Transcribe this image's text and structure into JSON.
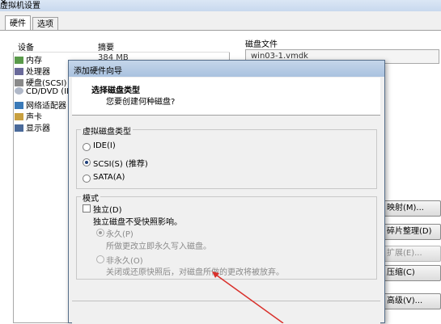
{
  "window": {
    "title": "虚拟机设置"
  },
  "tabs": [
    {
      "label": "硬件"
    },
    {
      "label": "选项"
    }
  ],
  "device_list": {
    "col_device": "设备",
    "col_summary": "摘要",
    "items": [
      {
        "label": "内存",
        "value": "384 MB",
        "icon": "memory-icon"
      },
      {
        "label": "处理器",
        "value": "",
        "icon": "cpu-icon"
      },
      {
        "label": "硬盘(SCSI)",
        "value": "",
        "icon": "hdd-icon"
      },
      {
        "label": "CD/DVD (ID",
        "value": "",
        "icon": "cdrom-icon"
      },
      {
        "label": "网络适配器",
        "value": "",
        "icon": "network-icon"
      },
      {
        "label": "声卡",
        "value": "",
        "icon": "sound-icon"
      },
      {
        "label": "显示器",
        "value": "",
        "icon": "display-icon"
      }
    ]
  },
  "disk_panel": {
    "label": "磁盘文件",
    "file": "win03-1.vmdk",
    "buttons": [
      {
        "label": "映射(M)...",
        "disabled": false
      },
      {
        "label": "碎片整理(D)",
        "disabled": false
      },
      {
        "label": "扩展(E)...",
        "disabled": true
      },
      {
        "label": "压缩(C)",
        "disabled": false
      },
      {
        "label": "高级(V)...",
        "disabled": false
      }
    ]
  },
  "wizard": {
    "title": "添加硬件向导",
    "heading": "选择磁盘类型",
    "subheading": "您要创建何种磁盘?",
    "disk_type_group": "虚拟磁盘类型",
    "disk_types": [
      {
        "label": "IDE(I)",
        "selected": false
      },
      {
        "label": "SCSI(S)   (推荐)",
        "selected": true
      },
      {
        "label": "SATA(A)",
        "selected": false
      }
    ],
    "mode_group": "模式",
    "independent_label": "独立(D)",
    "independent_desc": "独立磁盘不受快照影响。",
    "persistent_label": "永久(P)",
    "persistent_desc": "所做更改立即永久写入磁盘。",
    "nonpersistent_label": "非永久(O)",
    "nonpersistent_desc": "关闭或还原快照后，对磁盘所做的更改将被放弃。"
  },
  "colors": {
    "title_bar": "#c5d6ea",
    "accent_arrow": "#d9302b",
    "radio_dot": "#1f3f7a"
  }
}
